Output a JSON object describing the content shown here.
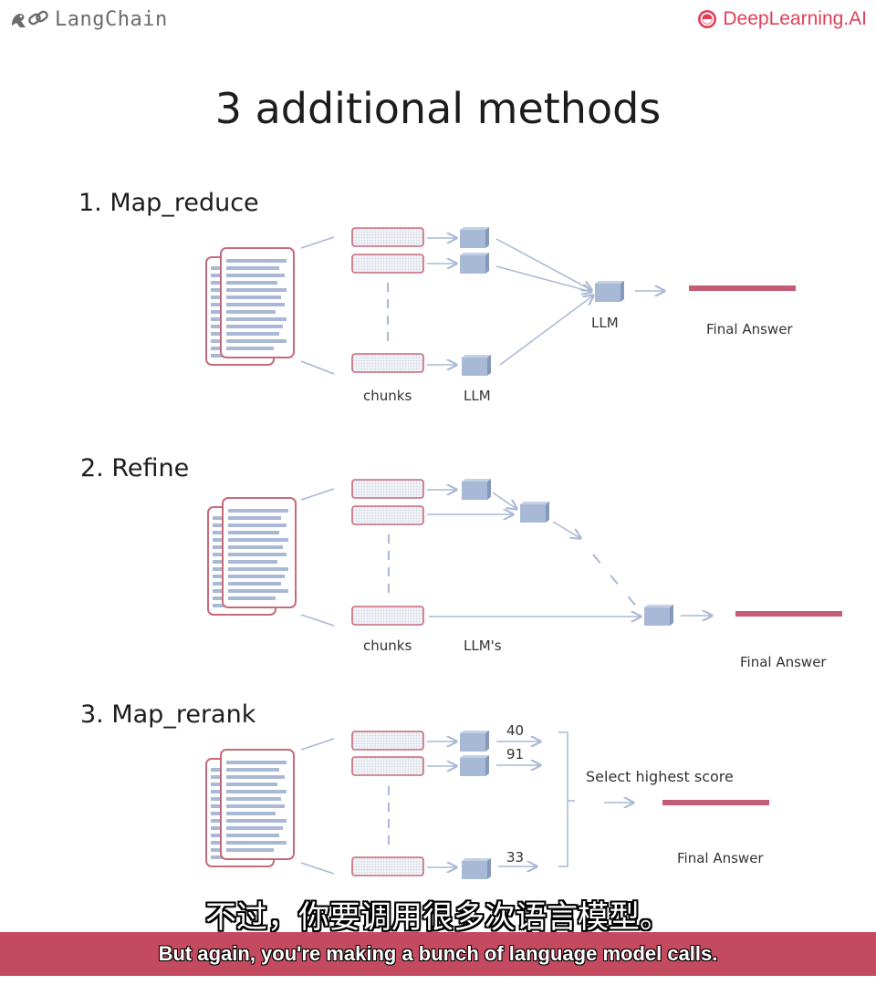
{
  "header": {
    "left_logo_text": "LangChain",
    "left_logo_icon": "parrot-chain-icon",
    "right_logo_text": "DeepLearning.AI",
    "right_logo_icon": "deeplearning-smile-icon"
  },
  "title": "3 additional methods",
  "methods": [
    {
      "title": "1. Map_reduce",
      "chunks_label": "chunks",
      "llm_label": "LLM",
      "combine_label": "LLM",
      "answer_label": "Final Answer"
    },
    {
      "title": "2. Refine",
      "chunks_label": "chunks",
      "llm_label": "LLM's",
      "answer_label": "Final Answer"
    },
    {
      "title": "3. Map_rerank",
      "scores": [
        "40",
        "91",
        "33"
      ],
      "select_label": "Select highest score",
      "answer_label": "Final Answer"
    }
  ],
  "subtitles": {
    "chinese": "不过，你要调用很多次语言模型。",
    "english": "But again, you're making a bunch of language model calls."
  },
  "colors": {
    "doc_border": "#c76b7b",
    "doc_lines": "#a9b8d4",
    "llm_block": "#a8b9d6",
    "answer_bar": "#c45d73",
    "subtitle_bar": "#c44a60"
  }
}
